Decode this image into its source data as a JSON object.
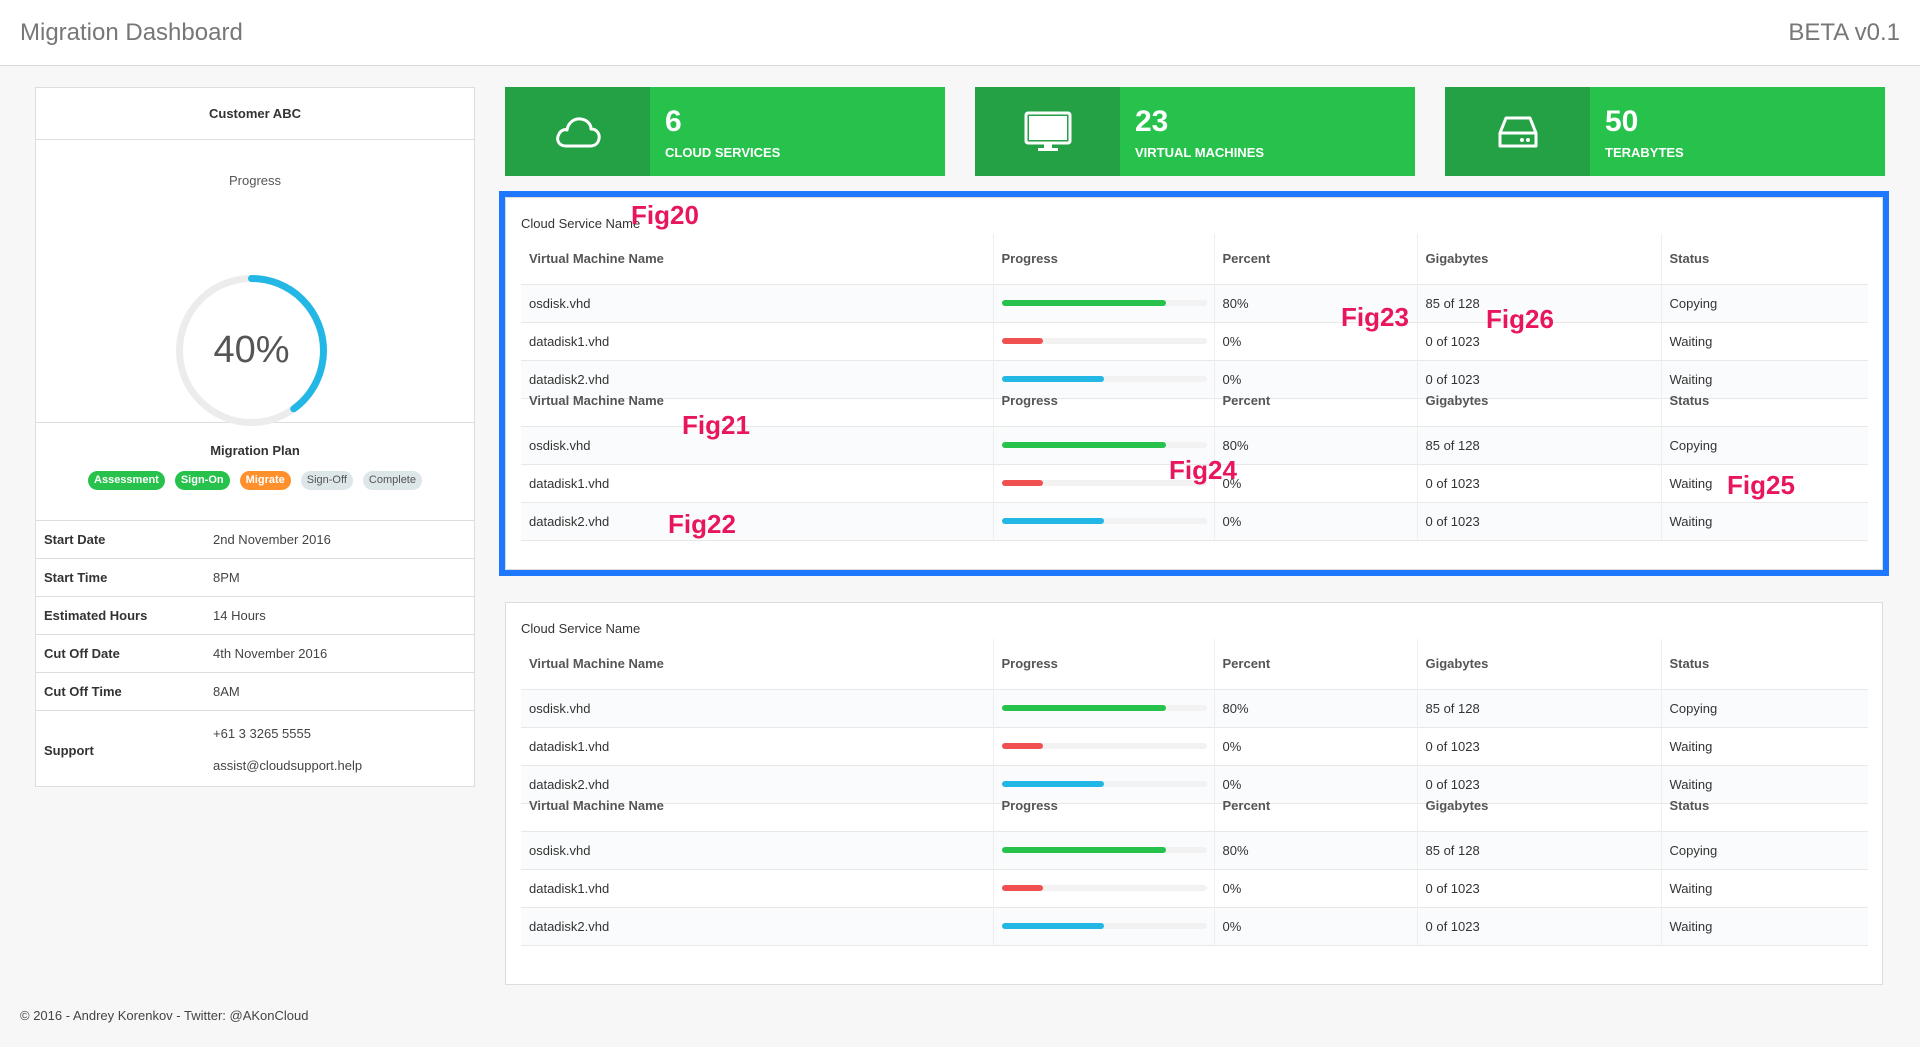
{
  "header": {
    "title": "Migration Dashboard",
    "version": "BETA v0.1"
  },
  "left": {
    "customer": "Customer ABC",
    "progress_label": "Progress",
    "progress_value": "40%",
    "progress_fraction": 0.4,
    "plan_title": "Migration Plan",
    "plan_badges": [
      {
        "label": "Assessment",
        "state": "done"
      },
      {
        "label": "Sign-On",
        "state": "done"
      },
      {
        "label": "Migrate",
        "state": "active"
      },
      {
        "label": "Sign-Off",
        "state": "pending"
      },
      {
        "label": "Complete",
        "state": "pending"
      }
    ],
    "info": [
      {
        "key": "Start Date",
        "value": "2nd November 2016"
      },
      {
        "key": "Start Time",
        "value": "8PM"
      },
      {
        "key": "Estimated Hours",
        "value": "14 Hours"
      },
      {
        "key": "Cut Off Date",
        "value": "4th November 2016"
      },
      {
        "key": "Cut Off Time",
        "value": "8AM"
      }
    ],
    "support": {
      "key": "Support",
      "phone": "+61 3 3265 5555",
      "email": "assist@cloudsupport.help"
    }
  },
  "stats": [
    {
      "number": "6",
      "label": "CLOUD SERVICES",
      "icon": "cloud-icon"
    },
    {
      "number": "23",
      "label": "VIRTUAL MACHINES",
      "icon": "monitor-icon"
    },
    {
      "number": "50",
      "label": "TERABYTES",
      "icon": "hard-drive-icon"
    }
  ],
  "table_headers": [
    "Virtual Machine Name",
    "Progress",
    "Percent",
    "Gigabytes",
    "Status"
  ],
  "cloud_services": [
    {
      "name": "Cloud Service Name",
      "tables": [
        {
          "rows": [
            {
              "name": "osdisk.vhd",
              "progress": 0.8,
              "color": "#27c24c",
              "percent": "80%",
              "gigabytes": "85 of 128",
              "status": "Copying"
            },
            {
              "name": "datadisk1.vhd",
              "progress": 0.2,
              "color": "#f05050",
              "percent": "0%",
              "gigabytes": "0 of 1023",
              "status": "Waiting"
            },
            {
              "name": "datadisk2.vhd",
              "progress": 0.5,
              "color": "#23b7e5",
              "percent": "0%",
              "gigabytes": "0 of 1023",
              "status": "Waiting"
            }
          ]
        },
        {
          "rows": [
            {
              "name": "osdisk.vhd",
              "progress": 0.8,
              "color": "#27c24c",
              "percent": "80%",
              "gigabytes": "85 of 128",
              "status": "Copying"
            },
            {
              "name": "datadisk1.vhd",
              "progress": 0.2,
              "color": "#f05050",
              "percent": "0%",
              "gigabytes": "0 of 1023",
              "status": "Waiting"
            },
            {
              "name": "datadisk2.vhd",
              "progress": 0.5,
              "color": "#23b7e5",
              "percent": "0%",
              "gigabytes": "0 of 1023",
              "status": "Waiting"
            }
          ]
        }
      ]
    },
    {
      "name": "Cloud Service Name",
      "tables": [
        {
          "rows": [
            {
              "name": "osdisk.vhd",
              "progress": 0.8,
              "color": "#27c24c",
              "percent": "80%",
              "gigabytes": "85 of 128",
              "status": "Copying"
            },
            {
              "name": "datadisk1.vhd",
              "progress": 0.2,
              "color": "#f05050",
              "percent": "0%",
              "gigabytes": "0 of 1023",
              "status": "Waiting"
            },
            {
              "name": "datadisk2.vhd",
              "progress": 0.5,
              "color": "#23b7e5",
              "percent": "0%",
              "gigabytes": "0 of 1023",
              "status": "Waiting"
            }
          ]
        },
        {
          "rows": [
            {
              "name": "osdisk.vhd",
              "progress": 0.8,
              "color": "#27c24c",
              "percent": "80%",
              "gigabytes": "85 of 128",
              "status": "Copying"
            },
            {
              "name": "datadisk1.vhd",
              "progress": 0.2,
              "color": "#f05050",
              "percent": "0%",
              "gigabytes": "0 of 1023",
              "status": "Waiting"
            },
            {
              "name": "datadisk2.vhd",
              "progress": 0.5,
              "color": "#23b7e5",
              "percent": "0%",
              "gigabytes": "0 of 1023",
              "status": "Waiting"
            }
          ]
        }
      ]
    }
  ],
  "annotations": [
    "Fig20",
    "Fig21",
    "Fig22",
    "Fig23",
    "Fig24",
    "Fig25",
    "Fig26"
  ],
  "colors": {
    "green": "#27c24c",
    "green_dark": "#23a144",
    "orange": "#ff902b",
    "highlight": "#1e78ff",
    "annotation": "#e8175d"
  },
  "footer": "© 2016 - Andrey Korenkov - Twitter: @AKonCloud"
}
